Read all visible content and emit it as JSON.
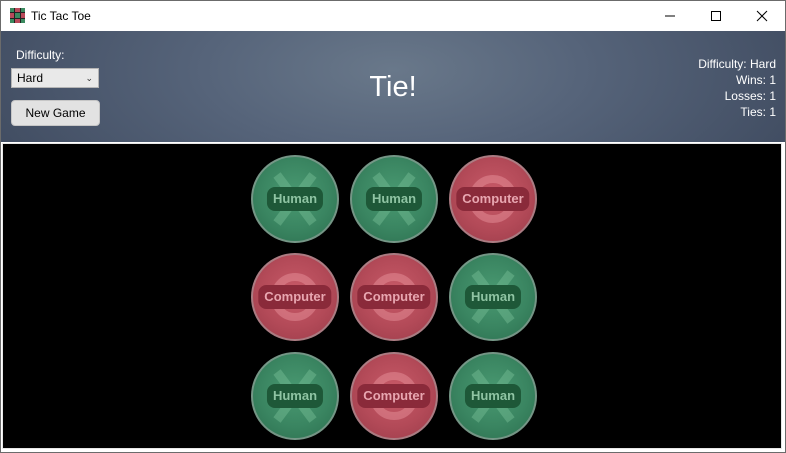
{
  "window": {
    "title": "Tic Tac Toe",
    "controls": [
      "minimize",
      "maximize",
      "close"
    ]
  },
  "header": {
    "difficulty_label": "Difficulty:",
    "difficulty_value": "Hard",
    "new_game_label": "New Game",
    "status": "Tie!",
    "stats": {
      "difficulty": "Difficulty: Hard",
      "wins": "Wins: 1",
      "losses": "Losses: 1",
      "ties": "Ties: 1"
    }
  },
  "board": {
    "cells": [
      {
        "player": "human",
        "mark": "X",
        "label": "Human"
      },
      {
        "player": "human",
        "mark": "X",
        "label": "Human"
      },
      {
        "player": "computer",
        "mark": "O",
        "label": "Computer"
      },
      {
        "player": "computer",
        "mark": "O",
        "label": "Computer"
      },
      {
        "player": "computer",
        "mark": "O",
        "label": "Computer"
      },
      {
        "player": "human",
        "mark": "X",
        "label": "Human"
      },
      {
        "player": "human",
        "mark": "X",
        "label": "Human"
      },
      {
        "player": "computer",
        "mark": "O",
        "label": "Computer"
      },
      {
        "player": "human",
        "mark": "X",
        "label": "Human"
      }
    ]
  },
  "colors": {
    "human": "#3a8561",
    "computer": "#b34a58",
    "board_background": "#000000"
  }
}
